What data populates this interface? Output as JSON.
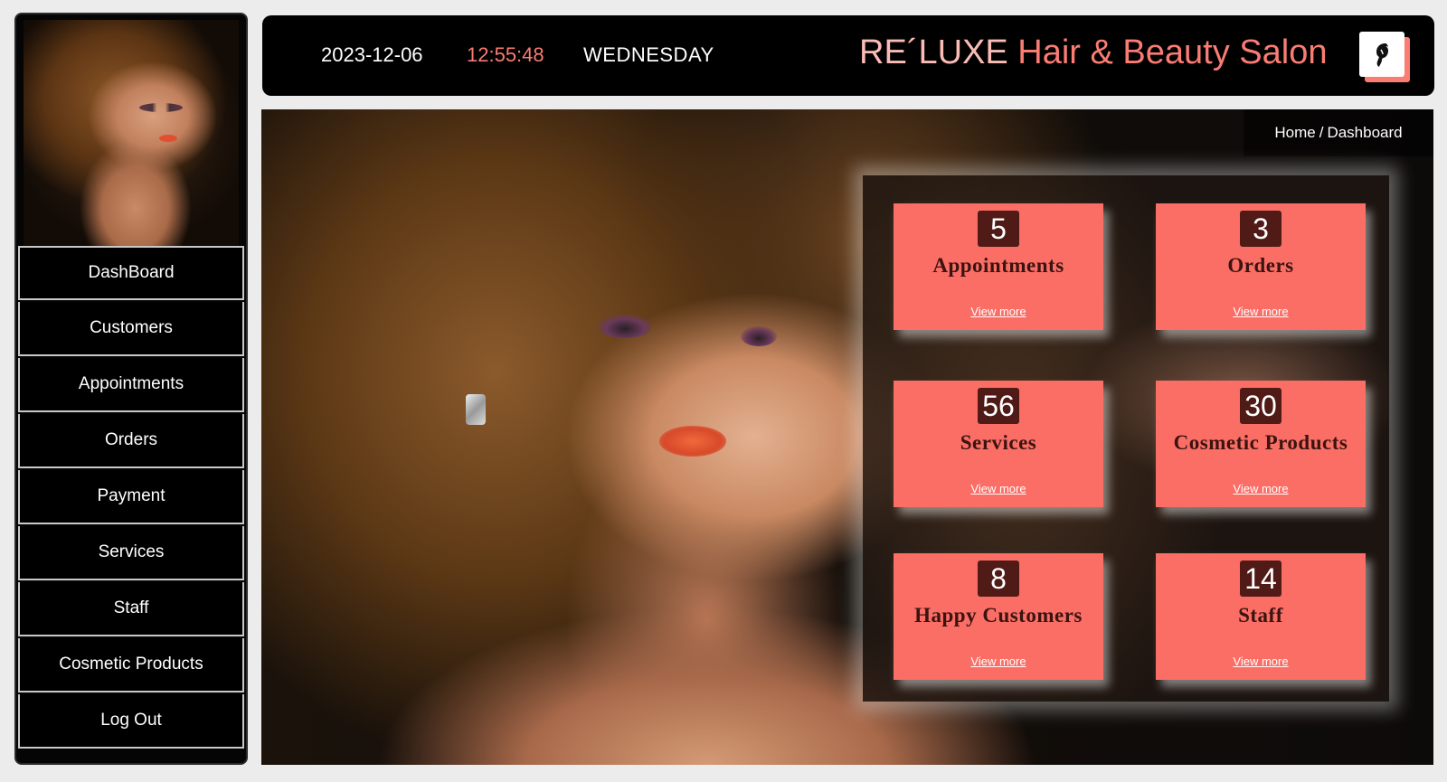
{
  "header": {
    "date": "2023-12-06",
    "time": "12:55:48",
    "day": "WEDNESDAY",
    "brand_main": "RE´LUXE",
    "brand_rest": " Hair & Beauty Salon"
  },
  "sidebar": {
    "items": [
      {
        "label": "DashBoard"
      },
      {
        "label": "Customers"
      },
      {
        "label": "Appointments"
      },
      {
        "label": "Orders"
      },
      {
        "label": "Payment"
      },
      {
        "label": "Services"
      },
      {
        "label": "Staff"
      },
      {
        "label": "Cosmetic Products"
      },
      {
        "label": "Log Out"
      }
    ]
  },
  "breadcrumb": {
    "home": "Home",
    "separator": "/",
    "current": "Dashboard"
  },
  "cards": [
    {
      "count": "5",
      "label": "Appointments",
      "link": "View more"
    },
    {
      "count": "3",
      "label": "Orders",
      "link": "View more"
    },
    {
      "count": "56",
      "label": "Services",
      "link": "View more"
    },
    {
      "count": "30",
      "label": "Cosmetic Products",
      "link": "View more"
    },
    {
      "count": "8",
      "label": "Happy Customers",
      "link": "View more"
    },
    {
      "count": "14",
      "label": "Staff",
      "link": "View more"
    }
  ],
  "colors": {
    "accent": "#fa7c72",
    "card_bg": "#fa6e66",
    "count_bg": "#501a16"
  },
  "icons": {
    "logo": "woman-silhouette-icon"
  }
}
